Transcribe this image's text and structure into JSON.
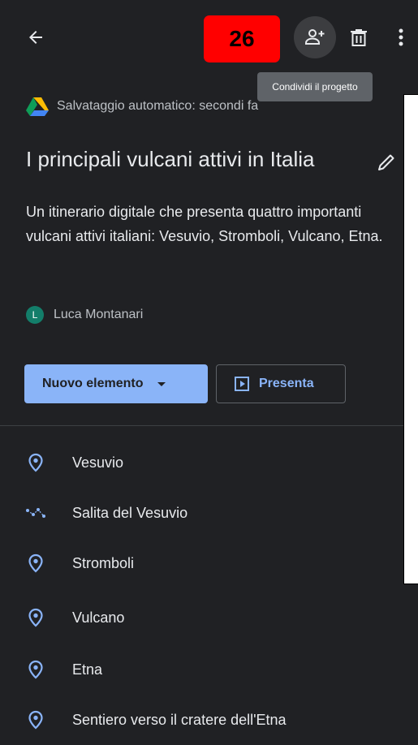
{
  "toolbar": {
    "badge": "26",
    "tooltip": "Condividi il progetto"
  },
  "autosave": {
    "text": "Salvataggio automatico: secondi fa"
  },
  "project": {
    "title": "I principali vulcani attivi in Italia",
    "description": "Un itinerario digitale che presenta quattro importanti vulcani attivi italiani: Vesuvio, Stromboli, Vulcano, Etna.",
    "author_initial": "L",
    "author": "Luca Montanari"
  },
  "actions": {
    "new_item": "Nuovo elemento",
    "present": "Presenta"
  },
  "items": [
    {
      "label": "Vesuvio",
      "icon": "place-icon"
    },
    {
      "label": "Salita del Vesuvio",
      "icon": "route-icon"
    },
    {
      "label": "Stromboli",
      "icon": "place-icon"
    },
    {
      "label": "Vulcano",
      "icon": "place-icon"
    },
    {
      "label": "Etna",
      "icon": "place-icon"
    },
    {
      "label": "Sentiero verso il cratere dell'Etna",
      "icon": "place-icon"
    }
  ],
  "colors": {
    "background": "#202124",
    "accent": "#8ab4f8",
    "badge": "#ff0000"
  }
}
